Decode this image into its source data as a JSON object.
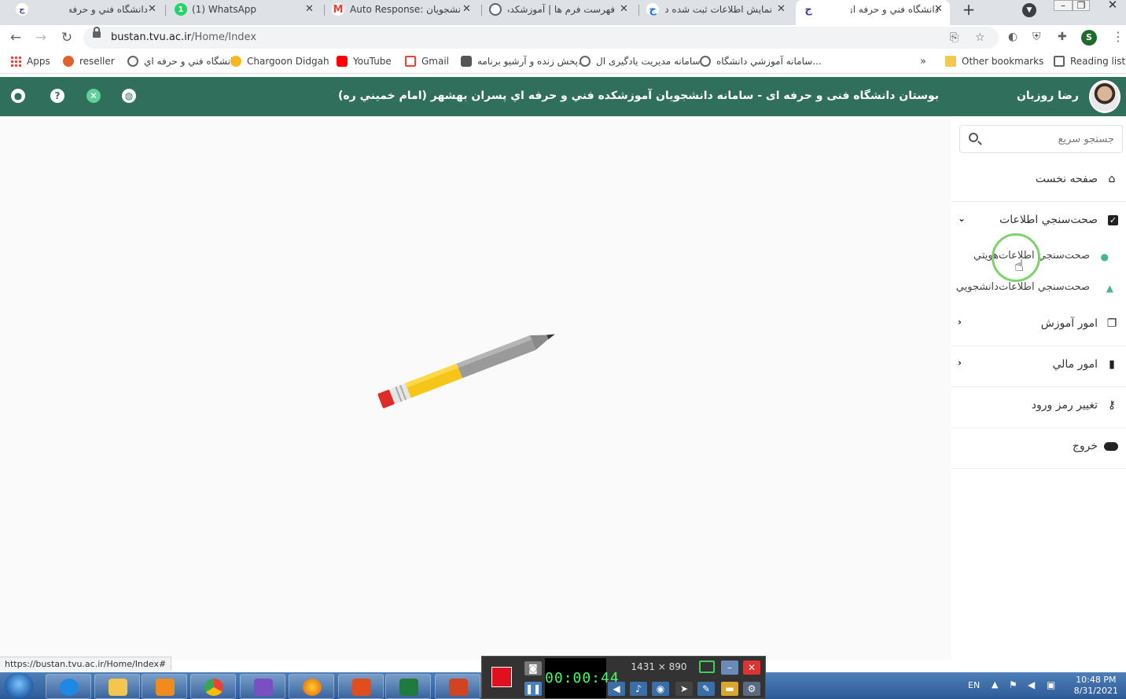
{
  "browser": {
    "tabs": [
      {
        "title": "دانشگاه فني و حرفه اي",
        "active": false
      },
      {
        "title": "(1) WhatsApp",
        "active": false
      },
      {
        "title": "Auto Response: ی دانشجویان",
        "active": false
      },
      {
        "title": "فهرست فرم ها | آموزشکده فنی پ",
        "active": false
      },
      {
        "title": "نمايش اطلاعات ثبت شده در فرم",
        "active": false
      },
      {
        "title": "دانشگاه فني و حرفه اي",
        "active": true
      }
    ],
    "url_host": "bustan.tvu.ac.ir",
    "url_path": "/Home/Index",
    "profile_initial": "S",
    "bookmarks": [
      "Apps",
      "reseller",
      "دانشگاه فني و حرفه اي",
      "Chargoon Didgah",
      "YouTube",
      "Gmail",
      "پخش زنده و آرشیو برنامه...",
      "سامانه مدیریت یادگیری ال...",
      "سامانه آموزشي دانشگاه..."
    ],
    "bookmarks_more": "»",
    "other_bookmarks": "Other bookmarks",
    "reading_list": "Reading list",
    "status_url": "https://bustan.tvu.ac.ir/Home/Index#"
  },
  "header": {
    "title": "بوستان دانشگاه فنی و حرفه ای - سامانه دانشجويان آموزشکده فني و حرفه اي پسران بهشهر (امام خميني ره)",
    "user_name": "رضا روزبان"
  },
  "sidebar": {
    "search_placeholder": "جستجو سريع",
    "home": "صفحه نخست",
    "verify": "صحت‌سنجي اطلاعات",
    "verify_identity": "صحت‌سنجي اطلاعات‌هويتي",
    "verify_student": "صحت‌سنجي اطلاعات‌دانشجويي",
    "education": "امور آموزش",
    "finance": "امور مالي",
    "change_password": "تغيير رمز ورود",
    "logout": "خروج"
  },
  "recorder": {
    "time": "00:00:44",
    "size": "1431 × 890"
  },
  "tray": {
    "lang": "EN",
    "time": "10:48 PM",
    "date": "8/31/2021"
  },
  "colors": {
    "header_bg": "#2f6f5c",
    "accent_icon": "#4ab595",
    "cursor_ring": "#7bd36a"
  }
}
